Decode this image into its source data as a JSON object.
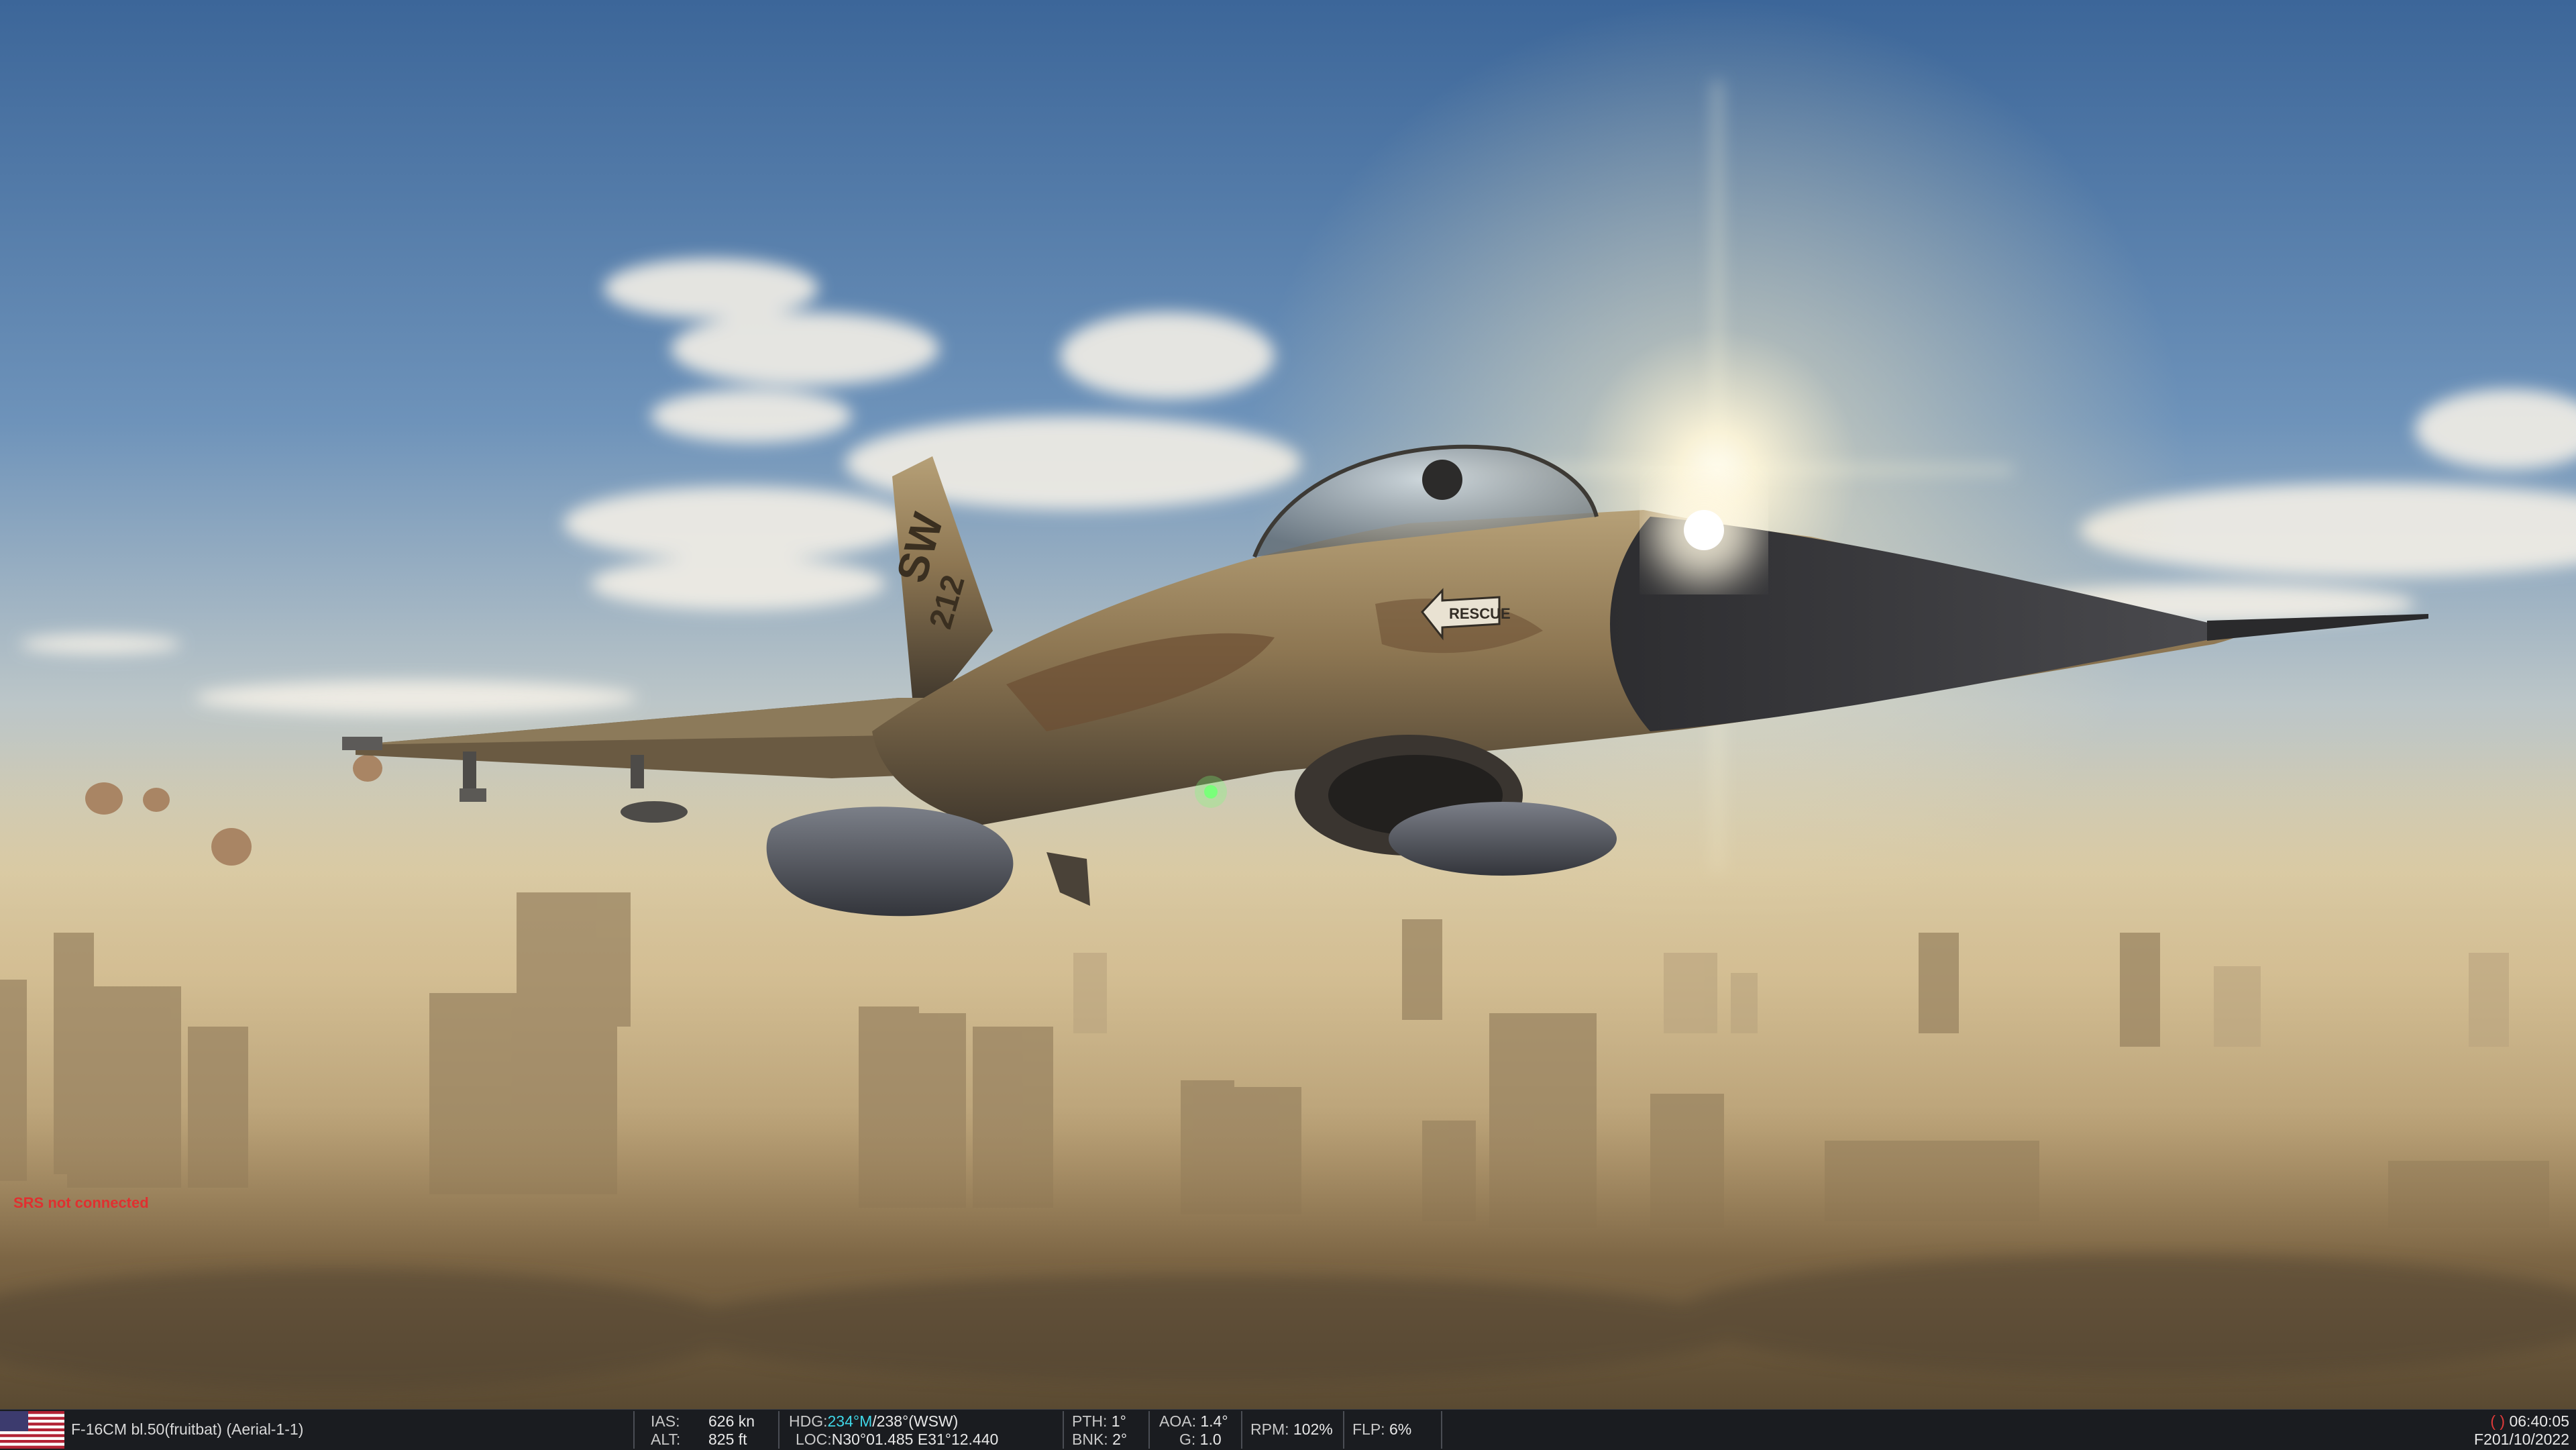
{
  "hud": {
    "srs_status": "SRS not connected"
  },
  "aircraft": {
    "tail_code": "SW",
    "tail_number": "212",
    "rescue_marking": "RESCUE"
  },
  "statusbar": {
    "unit": "F-16CM bl.50(fruitbat) (Aerial-1-1)",
    "ias_label": "IAS:",
    "ias_value": "626 kn",
    "alt_label": "ALT:",
    "alt_value": "825 ft",
    "hdg_label": "HDG:",
    "hdg_magnetic": "234°M",
    "hdg_true": "/238°(WSW)",
    "loc_label": "LOC:",
    "loc_value": "N30°01.485 E31°12.440",
    "pth_label": "PTH:",
    "pth_value": "1°",
    "bnk_label": "BNK:",
    "bnk_value": "2°",
    "aoa_label": "AOA:",
    "aoa_value": "1.4°",
    "g_label": "G:",
    "g_value": "1.0",
    "rpm_label": "RPM:",
    "rpm_value": "102%",
    "flp_label": "FLP:",
    "flp_value": "6%",
    "time_paren": "( )",
    "time_value": "06:40:05",
    "date_value": "F201/10/2022"
  },
  "colors": {
    "sky_top": "#3f6aa0",
    "haze": "#d9c49a",
    "aircraft_tan": "#9a8560",
    "statusbar_bg": "#1a1c20",
    "accent_cyan": "#3fd6e6",
    "alert_red": "#e03030"
  }
}
